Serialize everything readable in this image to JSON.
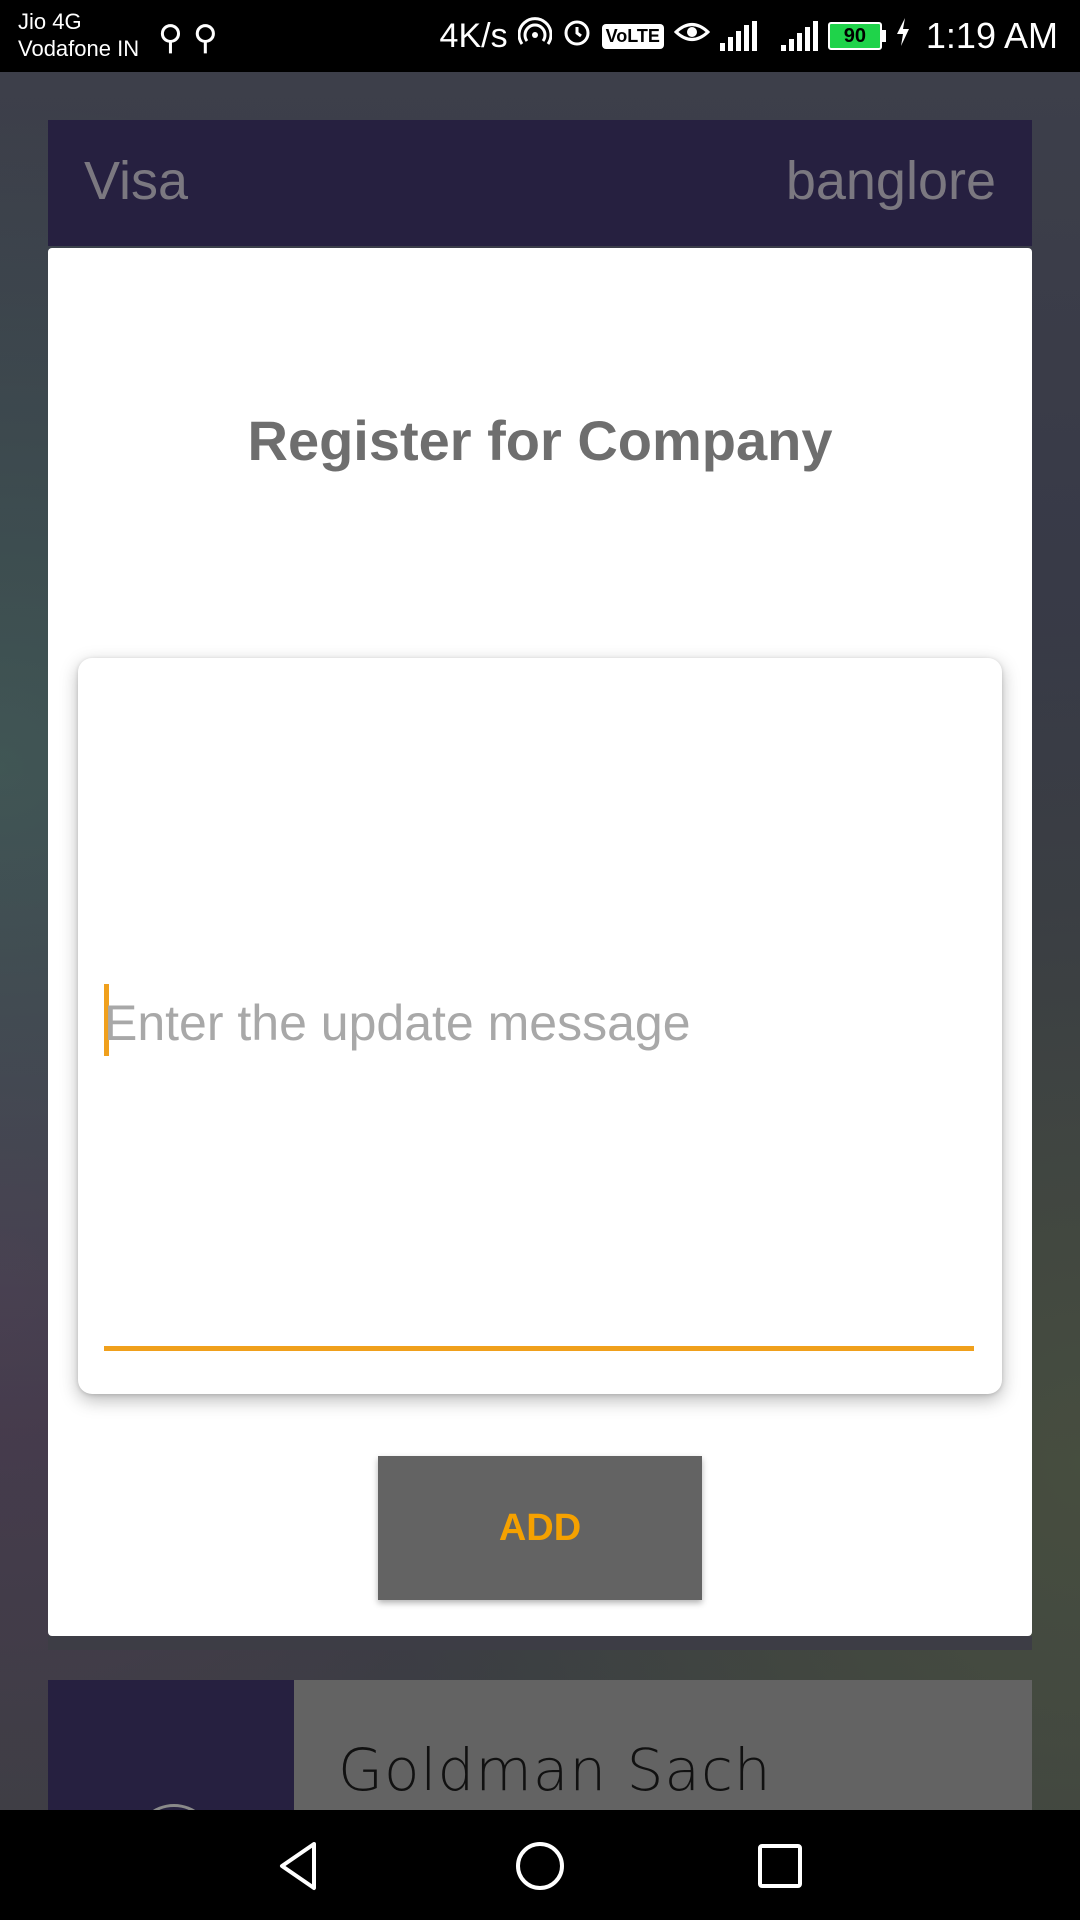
{
  "status_bar": {
    "carrier_primary": "Jio 4G",
    "carrier_secondary": "Vodafone IN",
    "network_speed": "4K/s",
    "volte_label": "VoLTE",
    "battery_level": "90",
    "time": "1:19 AM",
    "icons": [
      "usb-icon",
      "usb-icon",
      "hotspot-icon",
      "alarm-icon",
      "volte-icon",
      "eye-comfort-icon",
      "signal-4g-icon",
      "signal-icon",
      "battery-icon",
      "charging-icon"
    ]
  },
  "background_list": {
    "card1_left": "Visa",
    "card1_right": "banglore",
    "card2_title": "Goldman Sach"
  },
  "dialog": {
    "title": "Register for Company",
    "message_placeholder": "Enter the update message",
    "message_value": "",
    "add_label": "ADD"
  },
  "nav_bar": {
    "icons": [
      "back-icon",
      "home-icon",
      "recent-apps-icon"
    ]
  },
  "colors": {
    "accent": "#f0a01c",
    "button_bg": "#636363",
    "card_header_bg": "#262040",
    "title_text": "#6e6e6e"
  }
}
